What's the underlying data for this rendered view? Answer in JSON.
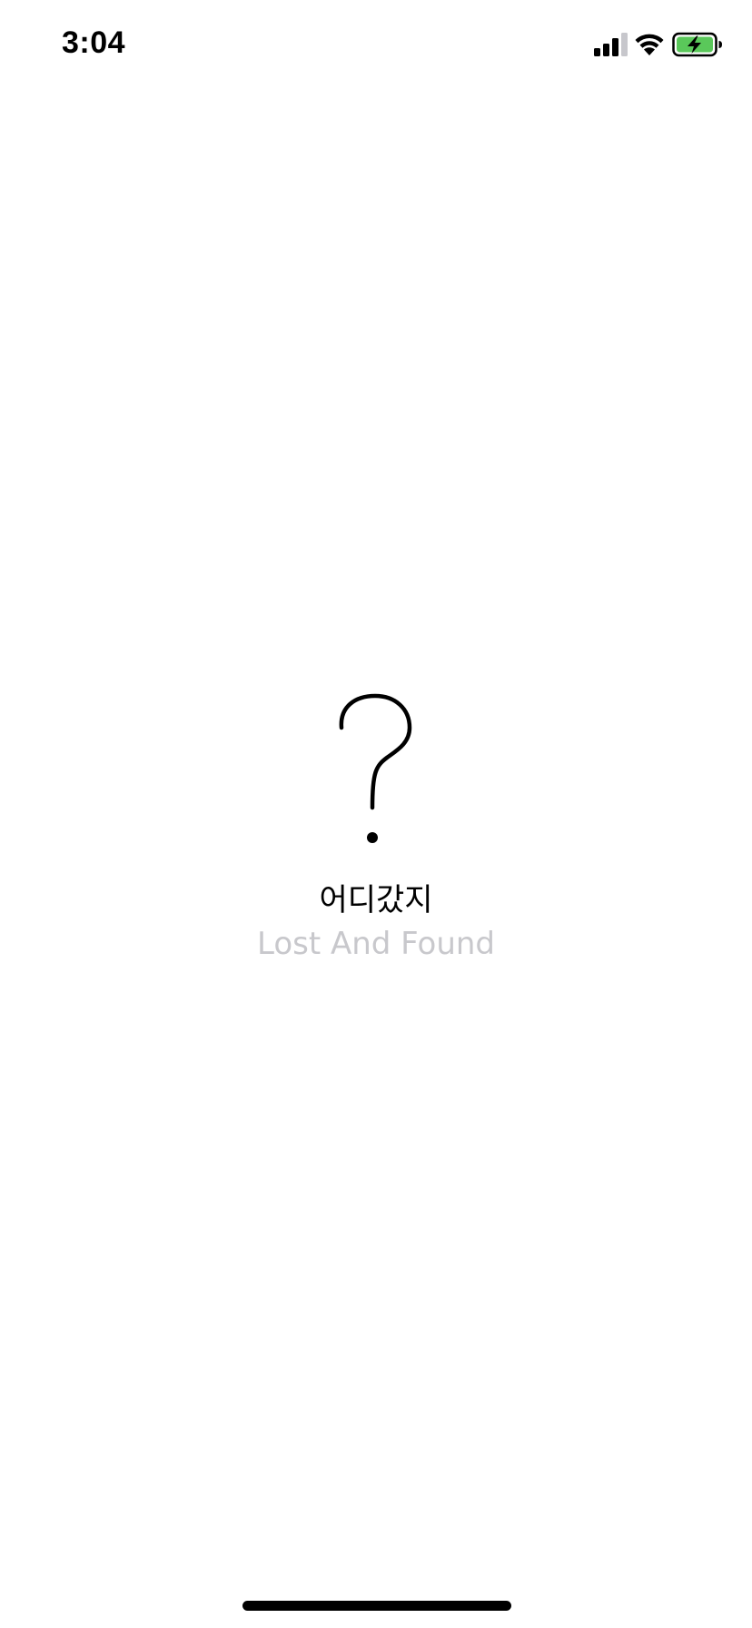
{
  "status_bar": {
    "time": "3:04",
    "signal": "cellular-signal-icon",
    "wifi": "wifi-icon",
    "battery": "battery-charging-icon",
    "battery_color": "#5ac85a"
  },
  "splash": {
    "logo_icon": "question-mark-icon",
    "title_ko": "어디갔지",
    "title_en": "Lost And Found",
    "title_en_color": "#c8c8cc"
  },
  "home_indicator": "home-indicator-bar"
}
